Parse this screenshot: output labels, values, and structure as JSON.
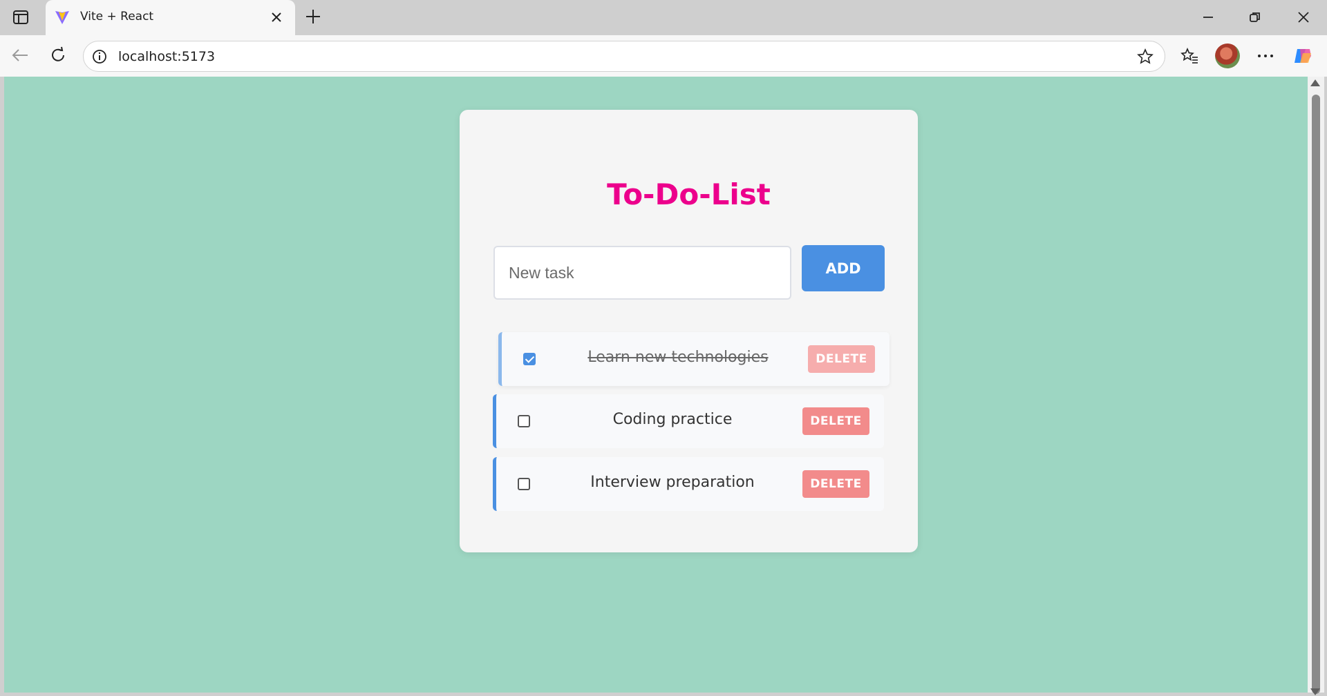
{
  "browser": {
    "tab_title": "Vite + React",
    "url": "localhost:5173"
  },
  "app": {
    "title": "To-Do-List",
    "input_placeholder": "New task",
    "input_value": "",
    "add_label": "ADD",
    "tasks": [
      {
        "label": "Learn new technologies",
        "completed": true,
        "delete_label": "DELETE"
      },
      {
        "label": "Coding practice",
        "completed": false,
        "delete_label": "DELETE"
      },
      {
        "label": "Interview preparation",
        "completed": false,
        "delete_label": "DELETE"
      }
    ]
  },
  "colors": {
    "page_background": "#9dd6c2",
    "title": "#ec008c",
    "add_button": "#4a90e2",
    "delete_button": "#f28b8b",
    "task_accent": "#4a90e2"
  }
}
